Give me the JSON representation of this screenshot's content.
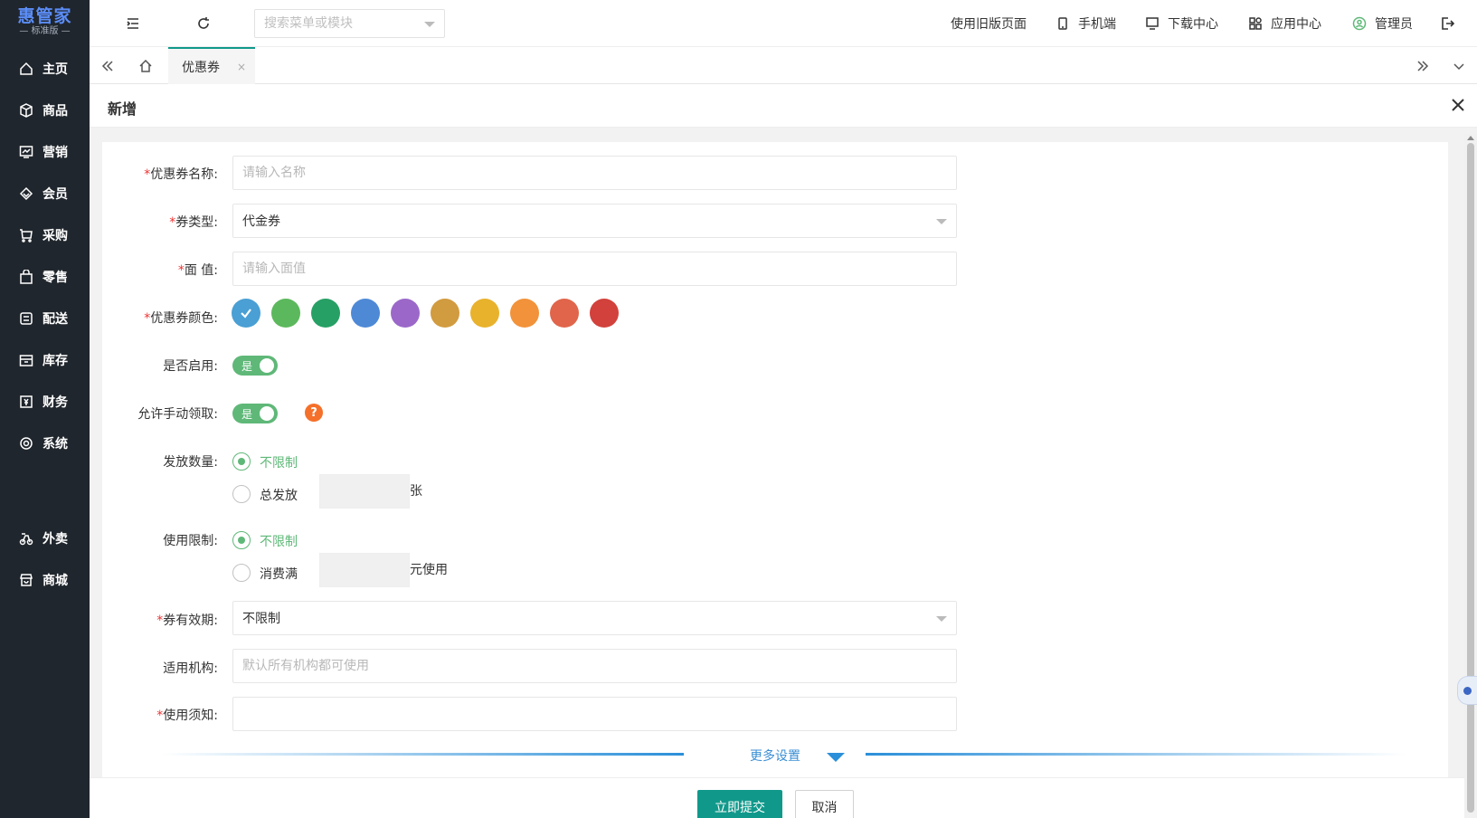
{
  "logo": {
    "main": "惠管家",
    "sub": "— 标准版 —"
  },
  "sidebar": {
    "items": [
      {
        "label": "主页",
        "icon": "home-icon"
      },
      {
        "label": "商品",
        "icon": "box-icon"
      },
      {
        "label": "营销",
        "icon": "chart-icon"
      },
      {
        "label": "会员",
        "icon": "diamond-icon"
      },
      {
        "label": "采购",
        "icon": "cart-icon"
      },
      {
        "label": "零售",
        "icon": "bag-icon"
      },
      {
        "label": "配送",
        "icon": "delivery-icon"
      },
      {
        "label": "库存",
        "icon": "inventory-icon"
      },
      {
        "label": "财务",
        "icon": "finance-icon"
      },
      {
        "label": "系统",
        "icon": "settings-icon"
      },
      {
        "label": "外卖",
        "icon": "bike-icon"
      },
      {
        "label": "商城",
        "icon": "store-icon"
      }
    ]
  },
  "topbar": {
    "search_placeholder": "搜索菜单或模块",
    "old_version": "使用旧版页面",
    "mobile": "手机端",
    "download": "下载中心",
    "apps": "应用中心",
    "user": "管理员"
  },
  "tabs": {
    "active": "优惠券",
    "close": "×"
  },
  "dialog": {
    "title": "新增"
  },
  "form": {
    "name": {
      "label": "优惠券名称:",
      "placeholder": "请输入名称"
    },
    "type": {
      "label": "券类型:",
      "value": "代金券"
    },
    "face_value": {
      "label": "面 值:",
      "placeholder": "请输入面值"
    },
    "color": {
      "label": "优惠券颜色:",
      "options": [
        "#4a9fd4",
        "#5cb85c",
        "#27a065",
        "#4e89d6",
        "#9b68c9",
        "#d19b3f",
        "#e8b22c",
        "#f2923a",
        "#e0654a",
        "#d2413c"
      ],
      "selected_index": 0
    },
    "enabled": {
      "label": "是否启用:",
      "value": "是"
    },
    "manual_claim": {
      "label": "允许手动领取:",
      "value": "是",
      "help": "?"
    },
    "quantity": {
      "label": "发放数量:",
      "opt1": "不限制",
      "opt2": "总发放",
      "unit": "张"
    },
    "limit": {
      "label": "使用限制:",
      "opt1": "不限制",
      "opt2": "消费满",
      "unit": "元使用"
    },
    "validity": {
      "label": "券有效期:",
      "value": "不限制"
    },
    "org": {
      "label": "适用机构:",
      "placeholder": "默认所有机构都可使用"
    },
    "notice": {
      "label": "使用须知:"
    },
    "more": "更多设置"
  },
  "actions": {
    "submit": "立即提交",
    "cancel": "取消"
  },
  "required_mark": "*"
}
